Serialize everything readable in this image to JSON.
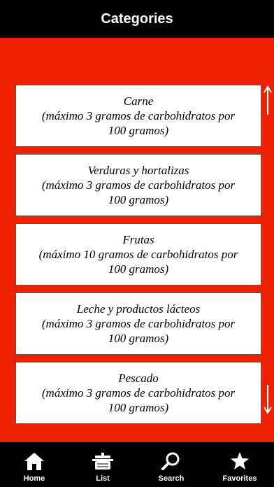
{
  "header": {
    "title": "Categories"
  },
  "categories": [
    {
      "name": "Carne",
      "detail_line1": "(máximo 3 gramos de carbohidratos por",
      "detail_line2": "100 gramos)"
    },
    {
      "name": "Verduras y hortalizas",
      "detail_line1": "(máximo 3 gramos de carbohidratos por",
      "detail_line2": "100 gramos)"
    },
    {
      "name": "Frutas",
      "detail_line1": "(máximo 10 gramos de carbohidratos por",
      "detail_line2": "100 gramos)"
    },
    {
      "name": "Leche y productos lácteos",
      "detail_line1": "(máximo 3 gramos de carbohidratos por",
      "detail_line2": "100 gramos)"
    },
    {
      "name": "Pescado",
      "detail_line1": "(máximo 3 gramos de carbohidratos por",
      "detail_line2": "100 gramos)"
    }
  ],
  "tabs": [
    {
      "label": "Home",
      "icon": "home-icon"
    },
    {
      "label": "List",
      "icon": "pot-icon"
    },
    {
      "label": "Search",
      "icon": "search-icon"
    },
    {
      "label": "Favorites",
      "icon": "star-icon"
    }
  ],
  "colors": {
    "background": "#ee2200",
    "bars": "#000000",
    "card": "#ffffff"
  }
}
